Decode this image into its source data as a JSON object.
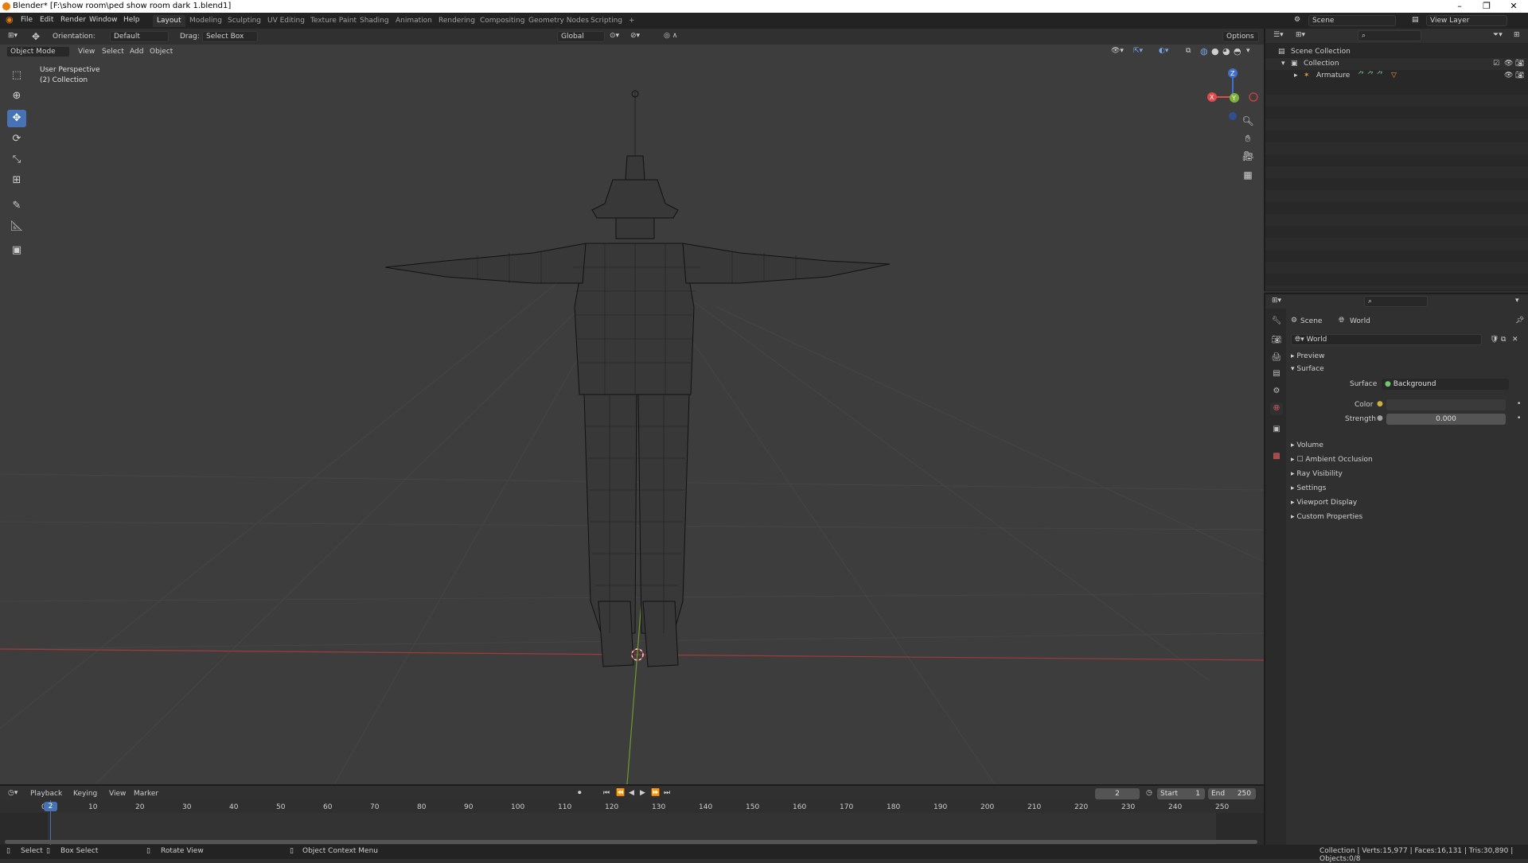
{
  "window": {
    "title": "Blender* [F:\\show room\\ped show room dark 1.blend1]",
    "minimize": "–",
    "maximize": "❐",
    "close": "✕"
  },
  "menubar": {
    "menus": [
      "File",
      "Edit",
      "Render",
      "Window",
      "Help"
    ],
    "workspaces": [
      "Layout",
      "Modeling",
      "Sculpting",
      "UV Editing",
      "Texture Paint",
      "Shading",
      "Animation",
      "Rendering",
      "Compositing",
      "Geometry Nodes",
      "Scripting"
    ],
    "add_tab": "+",
    "scene_label": "Scene",
    "view_layer_label": "View Layer"
  },
  "viewport_header": {
    "orientation_label": "Orientation:",
    "orientation_value": "Default",
    "drag_label": "Drag:",
    "drag_value": "Select Box",
    "transform_orientation": "Global",
    "options_label": "Options",
    "mode": "Object Mode",
    "menus": [
      "View",
      "Select",
      "Add",
      "Object"
    ]
  },
  "viewport": {
    "perspective_label": "User Perspective",
    "collection_label": "(2) Collection",
    "gizmo": {
      "x": "X",
      "y": "Y",
      "z": "Z"
    }
  },
  "outliner": {
    "scene_collection": "Scene Collection",
    "collection": "Collection",
    "armature": "Armature"
  },
  "properties": {
    "breadcrumb_scene": "Scene",
    "breadcrumb_world": "World",
    "world_name": "World",
    "panels": {
      "preview": "Preview",
      "surface": "Surface",
      "volume": "Volume",
      "ambient_occlusion": "Ambient Occlusion",
      "ray_visibility": "Ray Visibility",
      "settings": "Settings",
      "viewport_display": "Viewport Display",
      "custom_properties": "Custom Properties"
    },
    "surface_label": "Surface",
    "surface_value": "Background",
    "color_label": "Color",
    "strength_label": "Strength",
    "strength_value": "0.000"
  },
  "timeline": {
    "menus": [
      "Playback",
      "Keying",
      "View",
      "Marker"
    ],
    "current_frame": "2",
    "start_label": "Start",
    "start_value": "1",
    "end_label": "End",
    "end_value": "250",
    "ticks": [
      "0",
      "10",
      "20",
      "30",
      "40",
      "50",
      "60",
      "70",
      "80",
      "90",
      "100",
      "110",
      "120",
      "130",
      "140",
      "150",
      "160",
      "170",
      "180",
      "190",
      "200",
      "210",
      "220",
      "230",
      "240",
      "250"
    ],
    "playhead": "2"
  },
  "statusbar": {
    "select": "Select",
    "box_select": "Box Select",
    "rotate_view": "Rotate View",
    "context_menu": "Object Context Menu",
    "stats": "Collection | Verts:15,977 | Faces:16,131 | Tris:30,890 | Objects:0/8"
  },
  "colors": {
    "accent": "#4772b3",
    "x_axis": "#e04a4a",
    "y_axis": "#7db33a",
    "z_axis": "#3f6fd0",
    "brand": "#e87d0d"
  }
}
